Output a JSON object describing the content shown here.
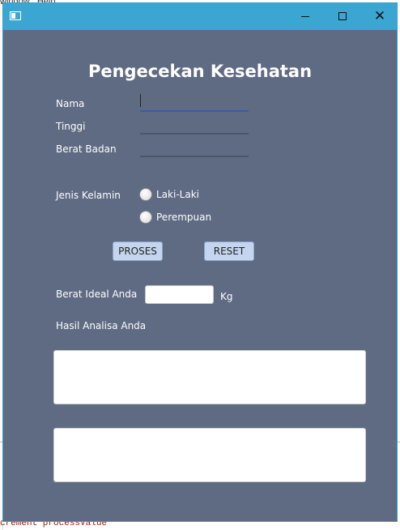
{
  "background": {
    "menu_text": "window   Help",
    "code_text": "crement processValue"
  },
  "window": {
    "title_bar": {
      "minimize_glyph": "—",
      "maximize_glyph": "☐",
      "close_glyph": "✕"
    }
  },
  "form": {
    "title": "Pengecekan Kesehatan",
    "nama_label": "Nama",
    "nama_value": "",
    "tinggi_label": "Tinggi",
    "tinggi_value": "",
    "berat_label": "Berat Badan",
    "berat_value": "",
    "gender_label": "Jenis Kelamin",
    "gender_options": [
      "Laki-Laki",
      "Perempuan"
    ],
    "proses_button": "PROSES",
    "reset_button": "RESET",
    "ideal_label": "Berat Ideal Anda",
    "ideal_value": "",
    "ideal_unit": "Kg",
    "analysis_label": "Hasil Analisa Anda",
    "analysis_text_1": "",
    "analysis_text_2": ""
  },
  "colors": {
    "titlebar": "#3ba6d2",
    "window_bg": "#5e6b83",
    "button_bg": "#c5d5ef"
  }
}
